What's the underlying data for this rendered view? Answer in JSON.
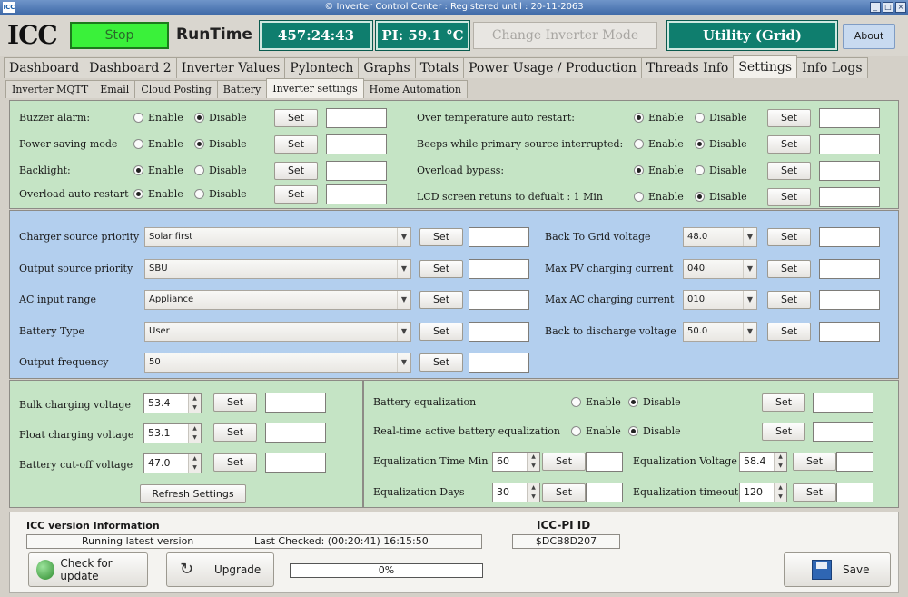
{
  "window": {
    "title": "© Inverter Control Center : Registered until : 20-11-2063",
    "app_icon": "ICC"
  },
  "header": {
    "logo_text": "ICC",
    "stop_label": "Stop",
    "runtime_label": "RunTime",
    "runtime_value": "457:24:43",
    "pi_temp": "PI: 59.1 °C",
    "change_mode_label": "Change Inverter Mode",
    "utility_label": "Utility (Grid)",
    "about_label": "About",
    "colors": {
      "stop_green": "#3af13a",
      "teal": "#0f7e6e"
    }
  },
  "main_tabs": [
    "Dashboard",
    "Dashboard 2",
    "Inverter Values",
    "Pylontech",
    "Graphs",
    "Totals",
    "Power Usage / Production",
    "Threads Info",
    "Settings",
    "Info Logs"
  ],
  "active_main_tab": "Settings",
  "sub_tabs": [
    "Inverter  MQTT",
    "Email",
    "Cloud Posting",
    "Battery",
    "Inverter settings",
    "Home Automation"
  ],
  "active_sub_tab": "Inverter settings",
  "common": {
    "set": "Set",
    "enable": "Enable",
    "disable": "Disable"
  },
  "toggles_left": [
    {
      "label": "Buzzer alarm:",
      "state": "Disable"
    },
    {
      "label": "Power saving mode",
      "state": "Disable"
    },
    {
      "label": "Backlight:",
      "state": "Enable"
    },
    {
      "label": "Overload auto restart",
      "state": "Enable"
    }
  ],
  "toggles_right": [
    {
      "label": "Over temperature auto restart:",
      "state": "Enable"
    },
    {
      "label": "Beeps while primary source interrupted:",
      "state": "Disable"
    },
    {
      "label": "Overload bypass:",
      "state": "Enable"
    },
    {
      "label": "LCD screen retuns to defualt : 1 Min",
      "state": "Disable"
    }
  ],
  "priorities": [
    {
      "label": "Charger source priority",
      "value": "Solar first"
    },
    {
      "label": "Output source priority",
      "value": "SBU"
    },
    {
      "label": "AC input range",
      "value": "Appliance"
    },
    {
      "label": "Battery Type",
      "value": "User"
    },
    {
      "label": "Output frequency",
      "value": "50"
    }
  ],
  "voltages_right": [
    {
      "label": "Back To Grid voltage",
      "value": "48.0"
    },
    {
      "label": "Max PV charging current",
      "value": "040"
    },
    {
      "label": "Max AC charging current",
      "value": "010"
    },
    {
      "label": "Back to discharge voltage",
      "value": "50.0"
    }
  ],
  "charging": [
    {
      "label": "Bulk charging voltage",
      "value": "53.4"
    },
    {
      "label": "Float charging voltage",
      "value": "53.1"
    },
    {
      "label": "Battery cut-off voltage",
      "value": "47.0"
    }
  ],
  "refresh_label": "Refresh Settings",
  "equalization": {
    "battery_eq_label": "Battery equalization",
    "battery_eq_state": "Disable",
    "realtime_label": "Real-time active battery equalization",
    "realtime_state": "Disable",
    "time_label": "Equalization Time Min",
    "time_value": "60",
    "days_label": "Equalization Days",
    "days_value": "30",
    "voltage_label": "Equalization Voltage",
    "voltage_value": "58.4",
    "timeout_label": "Equalization timeout",
    "timeout_value": "120"
  },
  "footer": {
    "version_heading": "ICC version Information",
    "version_status": "Running latest version",
    "last_checked": "Last Checked: (00:20:41)   16:15:50",
    "pi_id_heading": "ICC-PI ID",
    "pi_id": "$DCB8D207",
    "check_update_label": "Check for update",
    "upgrade_label": "Upgrade",
    "progress_text": "0%",
    "progress_fraction": 0,
    "save_label": "Save"
  }
}
